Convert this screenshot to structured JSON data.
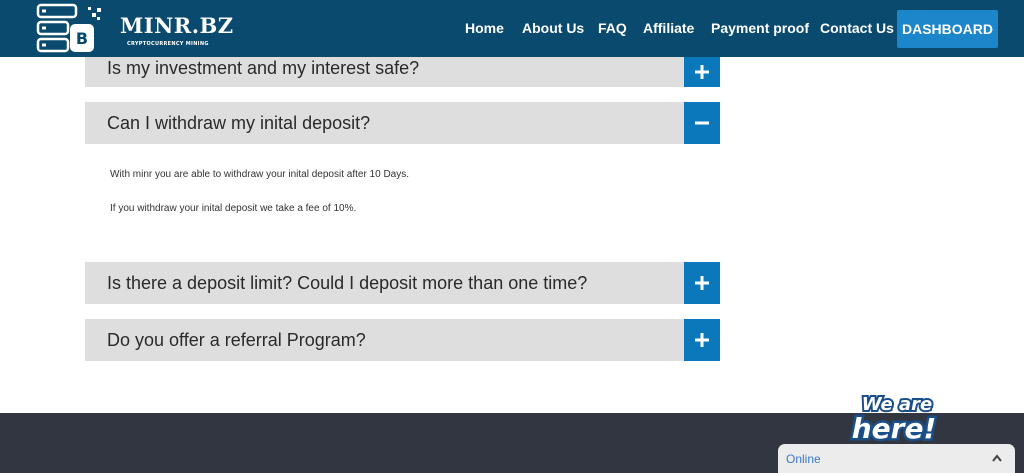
{
  "brand": {
    "name": "MINR.BZ",
    "tagline": "CRYPTOCURRENCY MINING",
    "icon": "server-bitcoin-icon"
  },
  "nav": {
    "links": [
      "Home",
      "About Us",
      "FAQ",
      "Affiliate",
      "Payment proof",
      "Contact Us"
    ],
    "dashboard": "DASHBOARD"
  },
  "faq": [
    {
      "question": "Is my investment and my interest safe?",
      "expanded": false,
      "toggle_icon": "plus-icon"
    },
    {
      "question": "Can I withdraw my inital deposit?",
      "expanded": true,
      "toggle_icon": "minus-icon",
      "answer": [
        "With minr you are able to withdraw your inital deposit after 10 Days.",
        "If you withdraw your inital deposit we take a fee of 10%."
      ]
    },
    {
      "question": "Is there a deposit limit? Could I deposit more than one time?",
      "expanded": false,
      "toggle_icon": "plus-icon"
    },
    {
      "question": "Do you offer a referral Program?",
      "expanded": false,
      "toggle_icon": "plus-icon"
    }
  ],
  "chat": {
    "badge": "We are here!",
    "status": "Online",
    "toggle_icon": "chevron-up-icon"
  },
  "colors": {
    "navbar": "#0a4a6e",
    "accent": "#0a78bb",
    "dashboard_button": "#1b86c9",
    "faq_bg": "#dedede",
    "footer": "#323641",
    "chat_online": "#3a79c8"
  }
}
